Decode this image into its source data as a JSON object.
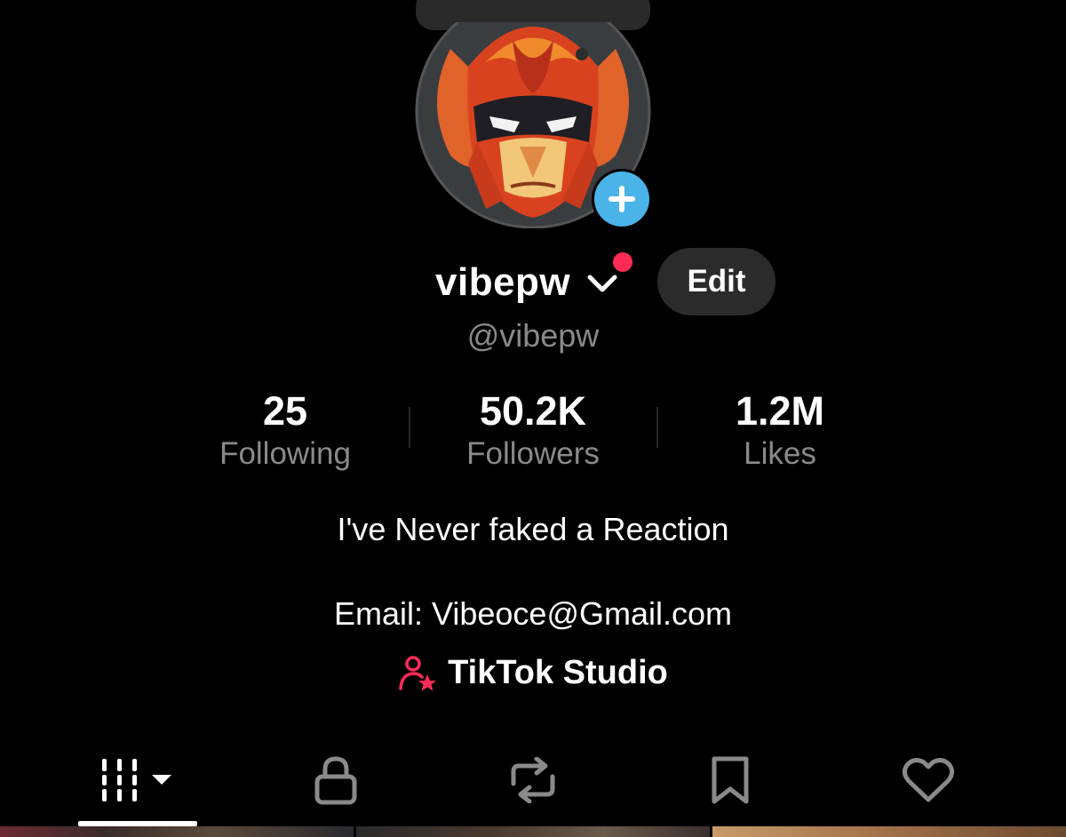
{
  "profile": {
    "display_name": "vibepw",
    "handle": "@vibepw",
    "edit_label": "Edit",
    "notification_dot_color": "#fe2c55",
    "add_button_color": "#4ab3e8"
  },
  "stats": [
    {
      "value": "25",
      "label": "Following"
    },
    {
      "value": "50.2K",
      "label": "Followers"
    },
    {
      "value": "1.2M",
      "label": "Likes"
    }
  ],
  "bio": {
    "line1": "I've Never faked a Reaction",
    "line2": "Email: Vibeoce@Gmail.com"
  },
  "studio": {
    "label": "TikTok Studio",
    "icon": "creator-person-star-icon",
    "icon_color": "#fe2c55"
  },
  "tabs": [
    {
      "id": "videos",
      "icon": "grid-bars-icon",
      "active": true
    },
    {
      "id": "private",
      "icon": "lock-icon",
      "active": false
    },
    {
      "id": "reposts",
      "icon": "repost-icon",
      "active": false
    },
    {
      "id": "favorites",
      "icon": "bookmark-icon",
      "active": false
    },
    {
      "id": "liked",
      "icon": "heart-icon",
      "active": false
    }
  ],
  "colors": {
    "background": "#000000",
    "secondary_text": "#8a8a8a",
    "button_bg": "#2b2b2b"
  }
}
